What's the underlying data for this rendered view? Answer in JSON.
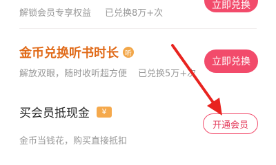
{
  "rows": [
    {
      "desc": "解锁会员专享权益",
      "count": "已兑换8万+次",
      "button": "立即兑换"
    },
    {
      "title": "金币兑换听书时长",
      "badge": "听",
      "desc": "解放双眼，随时收听超方便",
      "count": "已兑换5万+次",
      "button": "立即兑换"
    },
    {
      "title": "买会员抵现金",
      "badge": "¥",
      "desc": "金币当钱花，购买直接抵扣",
      "button": "开通会员"
    }
  ],
  "colors": {
    "accent": "#f24b6b",
    "title_orange": "#e06a18",
    "badge_orange": "#f5a94c",
    "annotation_arrow": "#e8231f"
  },
  "icons": {
    "listen": "listen-badge-icon",
    "yen": "yen-badge-icon",
    "annotation": "red-arrow-annotation"
  }
}
